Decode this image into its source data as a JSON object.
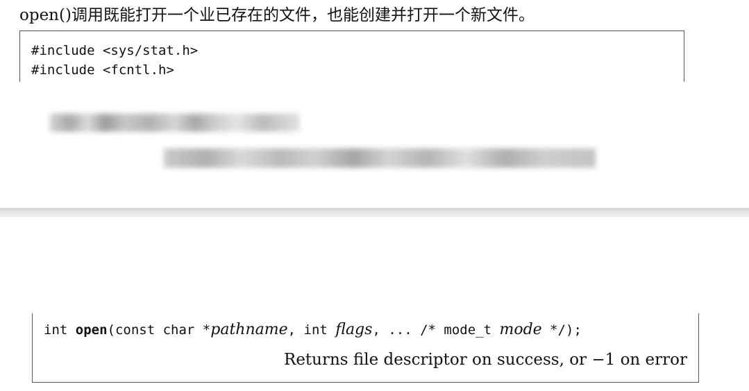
{
  "intro_text": "open()调用既能打开一个业已存在的文件，也能创建并打开一个新文件。",
  "code_block": {
    "lines": [
      "#include <sys/stat.h>",
      "#include <fcntl.h>"
    ]
  },
  "prototype": {
    "int1": "int ",
    "func_name": "open",
    "p_open": "(const char *",
    "pathname": "pathname",
    "sep1": ", int ",
    "flags": "flags",
    "sep2": ", ... /* mode_t ",
    "mode": "mode",
    "close": " */);",
    "returns": "Returns file descriptor on success, or −1 on error"
  }
}
